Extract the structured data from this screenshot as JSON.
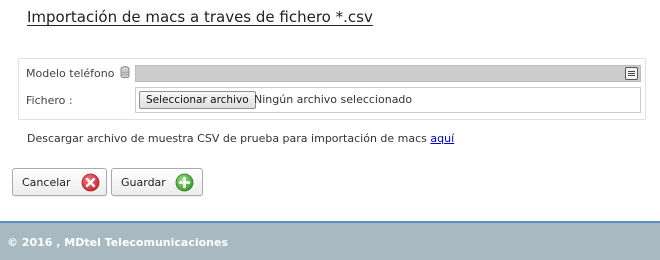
{
  "page": {
    "title": "Importación de macs a traves de fichero *.csv"
  },
  "form": {
    "model_label": "Modelo teléfono",
    "model_icon": "database-icon",
    "model_select_value": "",
    "model_select_icon": "list-icon",
    "file_label": "Fichero :",
    "file_button_label": "Seleccionar archivo",
    "file_status": "Ningún archivo seleccionado"
  },
  "download": {
    "text": "Descargar archivo de muestra CSV de prueba para importación de macs",
    "link_label": "aquí"
  },
  "actions": {
    "cancel_label": "Cancelar",
    "cancel_icon": "cancel-icon",
    "save_label": "Guardar",
    "save_icon": "add-icon"
  },
  "footer": {
    "text": "© 2016 , MDtel Telecomunicaciones"
  },
  "colors": {
    "footer_background": "#a8b9c2",
    "footer_border": "#5a8fc4",
    "cancel_icon": "#d9363e",
    "save_icon": "#5ab945",
    "link": "#0000cc"
  }
}
